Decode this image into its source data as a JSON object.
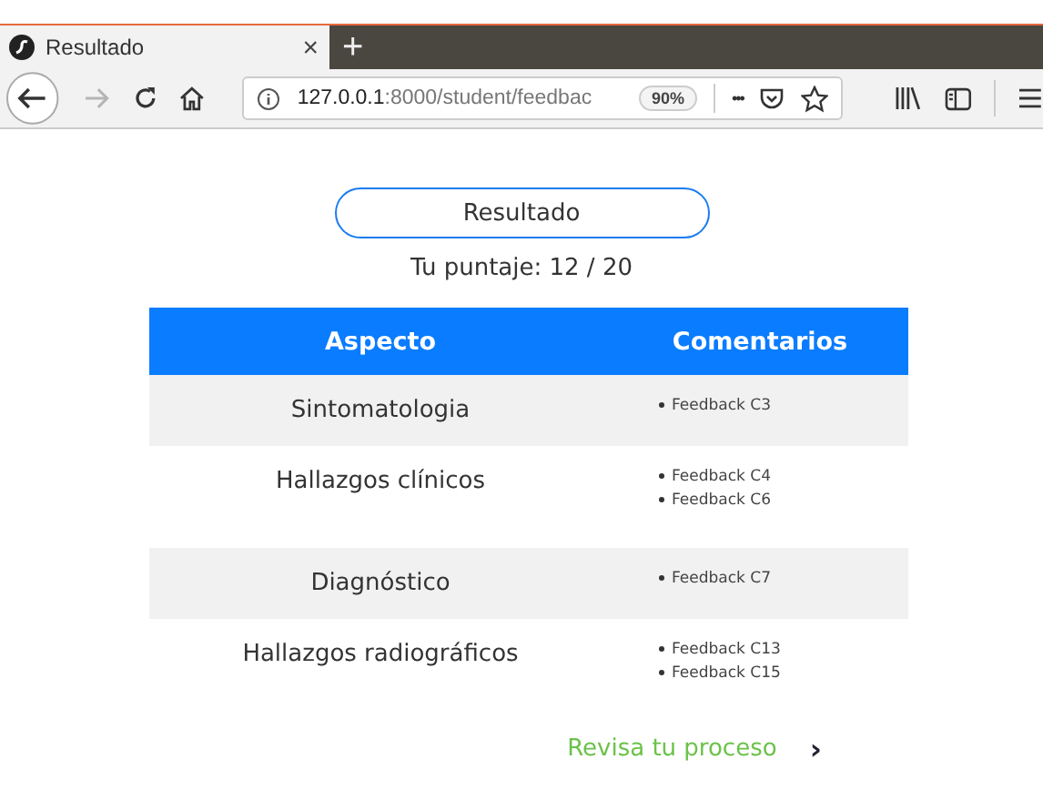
{
  "browser": {
    "tab_title": "Resultado",
    "tab_close": "×",
    "new_tab": "+",
    "url_host": "127.0.0.1",
    "url_path": ":8000/student/feedbac",
    "zoom": "90%",
    "more": "•••",
    "forward_disabled": true
  },
  "result_button": "Resultado",
  "score": "Tu puntaje: 12 / 20",
  "table": {
    "columns": [
      "Aspecto",
      "Comentarios"
    ],
    "rows": [
      {
        "aspect": "Sintomatologia",
        "comments": [
          "Feedback C3"
        ]
      },
      {
        "aspect": "Hallazgos clínicos",
        "comments": [
          "Feedback C4",
          "Feedback C6"
        ]
      },
      {
        "aspect": "Diagnóstico",
        "comments": [
          "Feedback C7"
        ]
      },
      {
        "aspect": "Hallazgos radiográficos",
        "comments": [
          "Feedback C13",
          "Feedback C15"
        ]
      }
    ]
  },
  "process_link": {
    "label": "Revisa tu proceso",
    "arrow": "›"
  }
}
